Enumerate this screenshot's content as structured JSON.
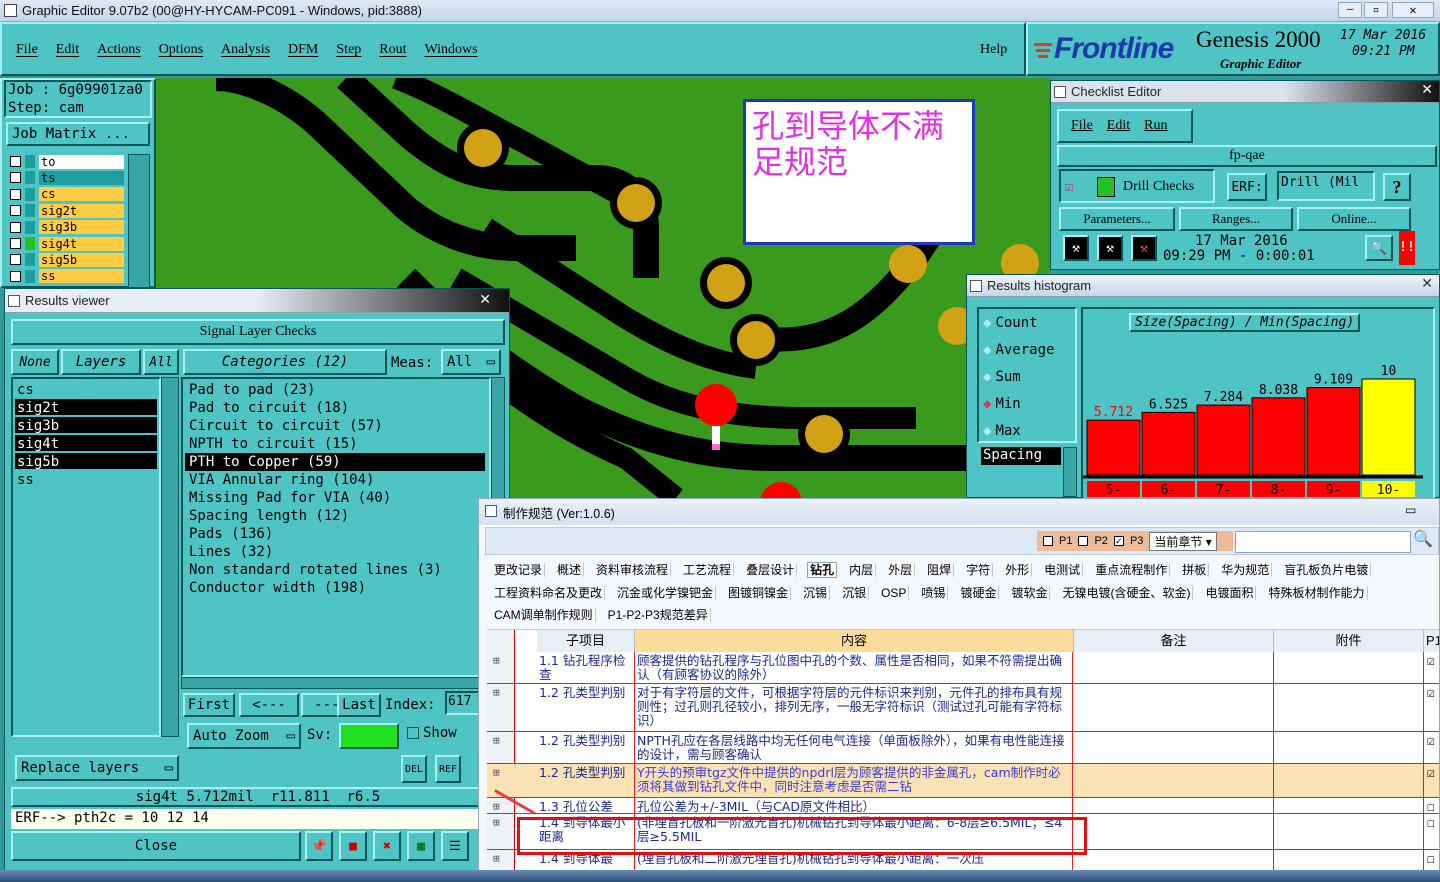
{
  "app": {
    "title": "Graphic Editor 9.07b2 (00@HY-HYCAM-PC091 - Windows, pid:3888)",
    "menu": [
      "File",
      "Edit",
      "Actions",
      "Options",
      "Analysis",
      "DFM",
      "Step",
      "Rout",
      "Windows"
    ],
    "help": "Help"
  },
  "brand": {
    "logo": "Frontline",
    "product": "Genesis 2000",
    "subtitle": "Graphic Editor",
    "date": "17 Mar 2016",
    "time": "09:21 PM"
  },
  "job": {
    "job_line": "Job : 6g09901za0",
    "step_line": "Step: cam",
    "matrix_btn": "Job Matrix ..."
  },
  "layers": [
    "to",
    "ts",
    "cs",
    "sig2t",
    "sig3b",
    "sig4t",
    "sig5b",
    "ss"
  ],
  "annotation": {
    "note": "孔到导体不满足规范"
  },
  "checklist": {
    "title": "Checklist Editor",
    "menu": [
      "File",
      "Edit",
      "Run"
    ],
    "name": "fp-qae",
    "item": "Drill Checks",
    "erf_label": "ERF:",
    "erf_value": "Drill (Mil",
    "help": "?",
    "params": "Parameters...",
    "ranges": "Ranges...",
    "online": "Online...",
    "run_date": "17 Mar 2016",
    "run_time": "09:29 PM - 0:00:01"
  },
  "histogram": {
    "title": "Results histogram",
    "modes": [
      "Count",
      "Average",
      "Sum",
      "Min",
      "Max"
    ],
    "selected": "Min",
    "category": "Spacing",
    "header": "Size(Spacing) / Min(Spacing)",
    "color_main": "#ff0000",
    "color_last": "#ffff00"
  },
  "chart_data": {
    "type": "bar",
    "title": "Size(Spacing) / Min(Spacing)",
    "categories": [
      "5-",
      "6-",
      "7-",
      "8-",
      "9-",
      "10-"
    ],
    "values": [
      5.712,
      6.525,
      7.284,
      8.038,
      9.109,
      10
    ],
    "value_labels": [
      "5.712",
      "6.525",
      "7.284",
      "8.038",
      "9.109",
      "10"
    ]
  },
  "results": {
    "title": "Results viewer",
    "header": "Signal Layer Checks",
    "none": "None",
    "layers": "Layers",
    "all": "All",
    "categories": "Categories (12)",
    "meas_label": "Meas:",
    "meas_value": "All",
    "layer_list": [
      "cs",
      "sig2t",
      "sig3b",
      "sig4t",
      "sig5b",
      "ss"
    ],
    "check_list": [
      "Pad to pad (23)",
      "Pad to circuit (18)",
      "Circuit to circuit (57)",
      "NPTH to circuit (15)",
      "PTH to Copper (59)",
      "VIA Annular ring (104)",
      "Missing Pad for VIA (40)",
      "Spacing length (12)",
      "Pads (136)",
      "Lines (32)",
      "Non standard rotated lines (3)",
      "Conductor width (198)"
    ],
    "first": "First",
    "prev": "<---",
    "next": "--->",
    "last": "Last",
    "index_label": "Index:",
    "index_value": "617",
    "auto_zoom": "Auto Zoom",
    "sv_label": "Sv:",
    "show": "Show",
    "replace": "Replace layers",
    "del": "DEL",
    "ref": "REF",
    "status": "sig4t 5.712mil  r11.811  r6.5",
    "erf_line": "ERF--> pth2c = 10 12 14",
    "close": "Close"
  },
  "spec": {
    "title": "制作规范 (Ver:1.0.6)",
    "p1": "P1",
    "p2": "P2",
    "p3": "P3",
    "chapter": "当前章节",
    "tabs1": [
      "更改记录",
      "概述",
      "资料审核流程",
      "工艺流程",
      "叠层设计",
      "钻孔",
      "内层",
      "外层",
      "阻焊",
      "字符",
      "外形",
      "电测试",
      "重点流程制作",
      "拼板",
      "华为规范",
      "盲孔板负片电镀"
    ],
    "tabs2": [
      "工程资料命名及更改",
      "沉金或化学镍钯金",
      "图镀铜镍金",
      "沉锡",
      "沉银",
      "OSP",
      "喷锡",
      "镀硬金",
      "镀软金",
      "无镍电镀(含硬金、软金)",
      "电镀面积",
      "特殊板材制作能力"
    ],
    "tabs3": [
      "CAM调单制作规则",
      "P1-P2-P3规范差异"
    ],
    "columns": [
      "子项目",
      "内容",
      "备注",
      "附件",
      "P1"
    ],
    "rows": [
      {
        "sub": "1.1 钻孔程序检查",
        "content": "顾客提供的钻孔程序与孔位图中孔的个数、属性是否相同，如果不符需提出确认（有顾客协议的除外）"
      },
      {
        "sub": "1.2 孔类型判别",
        "content": "对于有字符层的文件，可根据字符层的元件标识来判别，元件孔的排布具有规则性；过孔则孔径较小，排列无序，一般无字符标识（测试过孔可能有字符标识）"
      },
      {
        "sub": "1.2 孔类型判别",
        "content": "NPTH孔应在各层线路中均无任何电气连接（单面板除外），如果有电性能连接的设计，需与顾客确认"
      },
      {
        "sub": "1.2 孔类型判别",
        "content": "Y开头的预审tgz文件中提供的npdrl层为顾客提供的非金属孔，cam制作时必须将其做到钻孔文件中，同时注意考虑是否需二钻"
      },
      {
        "sub": "1.3 孔位公差",
        "content": "孔位公差为+/-3MIL（与CAD原文件相比）"
      },
      {
        "sub": "1.4 到导体最小距离",
        "content": "(非埋盲孔板和一阶激光盲孔)机械钻孔到导体最小距离：6-8层≥6.5MIL；≤4层≥5.5MIL"
      },
      {
        "sub": "1.4 到导体最",
        "content": "(埋盲孔板和二阶激光埋盲孔)机械钻孔到导体最小距离：一次压"
      }
    ]
  }
}
